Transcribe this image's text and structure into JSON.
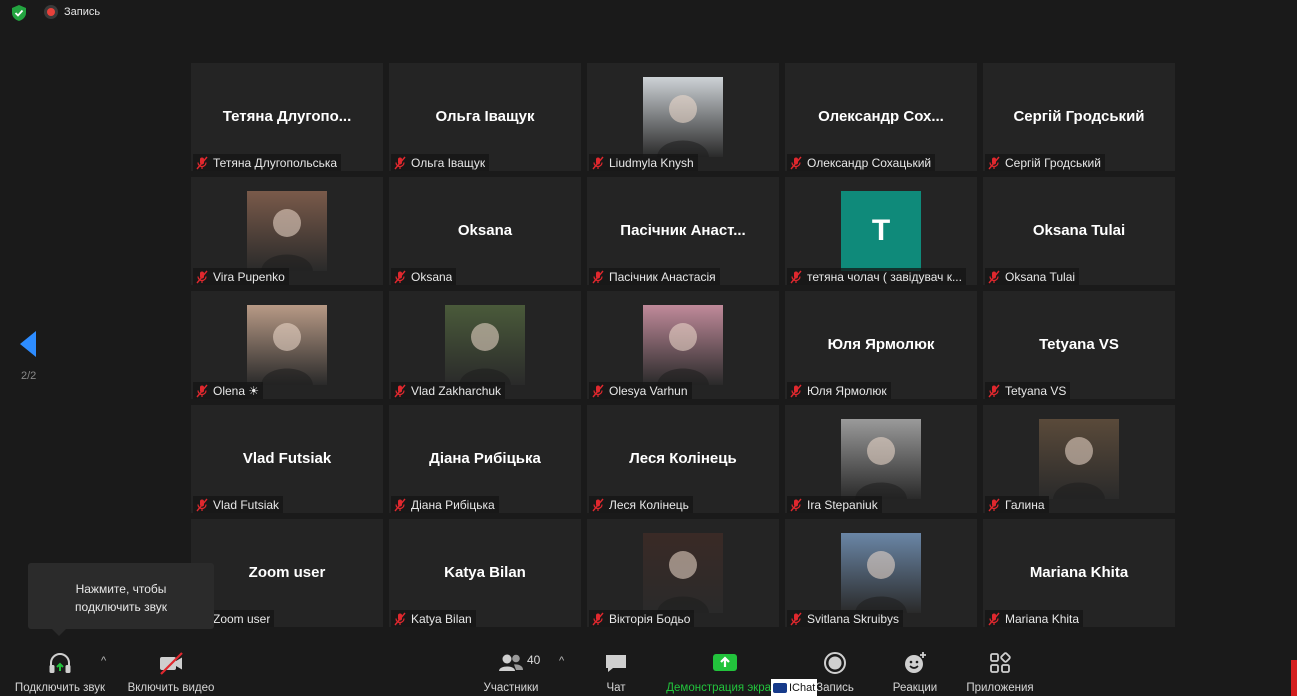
{
  "topbar": {
    "record_label": "Запись"
  },
  "pager": {
    "label": "2/2"
  },
  "tooltip": {
    "line1": "Нажмите, чтобы",
    "line2": "подключить звук"
  },
  "tiles": [
    {
      "bigname": "Тетяна  Длугопо...",
      "label": "Тетяна Длугопольська",
      "photo": null
    },
    {
      "bigname": "Ольга Іващук",
      "label": "Ольга Іващук",
      "photo": null
    },
    {
      "bigname": "",
      "label": "Liudmyla Knysh",
      "photo": "#cdd2d6"
    },
    {
      "bigname": "Олександр  Сох...",
      "label": "Олександр Сохацький",
      "photo": null
    },
    {
      "bigname": "Сергій Гродський",
      "label": "Сергій Гродський",
      "photo": null
    },
    {
      "bigname": "",
      "label": "Vira Pupenko",
      "photo": "#7a5a4a"
    },
    {
      "bigname": "Oksana",
      "label": "Oksana",
      "photo": null
    },
    {
      "bigname": "Пасічник  Анаст...",
      "label": "Пасічник Анастасія",
      "photo": null
    },
    {
      "bigname": "",
      "label": "тетяна чолач ( завідувач к...",
      "photo": "avatar",
      "avatar_letter": "T",
      "avatar_color": "#0f8a7a"
    },
    {
      "bigname": "Oksana Tulai",
      "label": "Oksana Tulai",
      "photo": null
    },
    {
      "bigname": "",
      "label": "Olena ☀",
      "photo": "#b89a86"
    },
    {
      "bigname": "",
      "label": "Vlad Zakharchuk",
      "photo": "#4a5a3a"
    },
    {
      "bigname": "",
      "label": "Olesya Varhun",
      "photo": "#c08a9a"
    },
    {
      "bigname": "Юля Ярмолюк",
      "label": "Юля Ярмолюк",
      "photo": null
    },
    {
      "bigname": "Tetyana VS",
      "label": "Tetyana VS",
      "photo": null
    },
    {
      "bigname": "Vlad Futsiak",
      "label": "Vlad Futsiak",
      "photo": null
    },
    {
      "bigname": "Діана Рибіцька",
      "label": "Діана Рибіцька",
      "photo": null
    },
    {
      "bigname": "Леся Колінець",
      "label": "Леся Колінець",
      "photo": null
    },
    {
      "bigname": "",
      "label": "Ira Stepaniuk",
      "photo": "#9a9a9a"
    },
    {
      "bigname": "",
      "label": "Галина",
      "photo": "#5a4a3a"
    },
    {
      "bigname": "Zoom user",
      "label": "Zoom user",
      "photo": null,
      "no_mic": true
    },
    {
      "bigname": "Katya Bilan",
      "label": "Katya Bilan",
      "photo": null
    },
    {
      "bigname": "",
      "label": "Вікторія Бодьо",
      "photo": "#3a2a26"
    },
    {
      "bigname": "",
      "label": "Svitlana Skruibys",
      "photo": "#6a86a6"
    },
    {
      "bigname": "Mariana Khita",
      "label": "Mariana Khita",
      "photo": null
    }
  ],
  "toolbar": {
    "audio_label": "Подключить звук",
    "video_label": "Включить видео",
    "participants_label": "Участники",
    "participants_count": "40",
    "chat_label": "Чат",
    "share_label": "Демонстрация экрана",
    "record_label": "Запись",
    "reactions_label": "Реакции",
    "apps_label": "Приложения",
    "ichat_label": "IChat"
  },
  "colors": {
    "background": "#1a1a1a",
    "tile": "#242424",
    "share_green": "#22c33c",
    "mute_red": "#e0282e"
  }
}
